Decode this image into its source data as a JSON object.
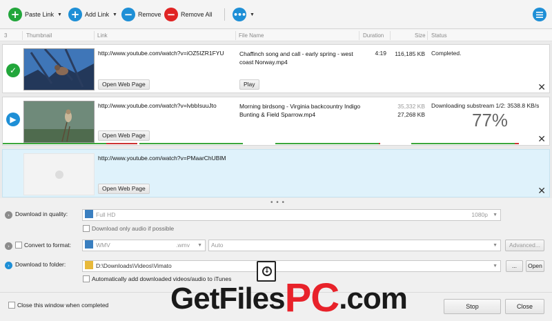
{
  "toolbar": {
    "paste_link": "Paste Link",
    "add_link": "Add Link",
    "remove": "Remove",
    "remove_all": "Remove All",
    "colors": {
      "green": "#22a63b",
      "blue": "#1e8fd6",
      "red": "#e02424"
    }
  },
  "columns": {
    "count": "3",
    "thumbnail": "Thumbnail",
    "link": "Link",
    "file_name": "File Name",
    "duration": "Duration",
    "size": "Size",
    "status": "Status"
  },
  "items": [
    {
      "link": "http://www.youtube.com/watch?v=iOZ5IZR1FYU",
      "file_name": "Chaffinch song and call - early spring - west coast Norway.mp4",
      "duration": "4:19",
      "size": "116,185 KB",
      "status": "Completed.",
      "open_web_page": "Open Web Page",
      "play": "Play",
      "status_icon": "checkmark-icon"
    },
    {
      "link": "http://www.youtube.com/watch?v=lvbbIsuuJto",
      "file_name": "Morning birdsong - Virginia backcountry Indigo Bunting & Field Sparrow.mp4",
      "size_total": "35,332 KB",
      "size_done": "27,268 KB",
      "status": "Downloading substream 1/2: 3538.8 KB/s",
      "percent": "77%",
      "progress": 0.77,
      "open_web_page": "Open Web Page",
      "status_icon": "play-icon"
    },
    {
      "link": "http://www.youtube.com/watch?v=PMaarChUBlM",
      "open_web_page": "Open Web Page"
    }
  ],
  "options": {
    "quality_label": "Download in quality:",
    "quality_value": "Full HD",
    "quality_res": "1080p",
    "audio_only": "Download only audio if possible",
    "convert_label": "Convert to format:",
    "format_value": "WMV",
    "format_ext": ".wmv",
    "format_preset": "Auto",
    "advanced": "Advanced...",
    "folder_label": "Download to folder:",
    "folder_value": "D:\\Downloads\\Videos\\Vimato",
    "browse": "...",
    "open": "Open",
    "auto_add": "Automatically add downloaded videos/audio to iTunes"
  },
  "footer": {
    "close_when_done": "Close this window when completed",
    "stop": "Stop",
    "close": "Close"
  },
  "watermark": {
    "text1": "GetFiles",
    "text2": "PC",
    "text3": ".com"
  }
}
